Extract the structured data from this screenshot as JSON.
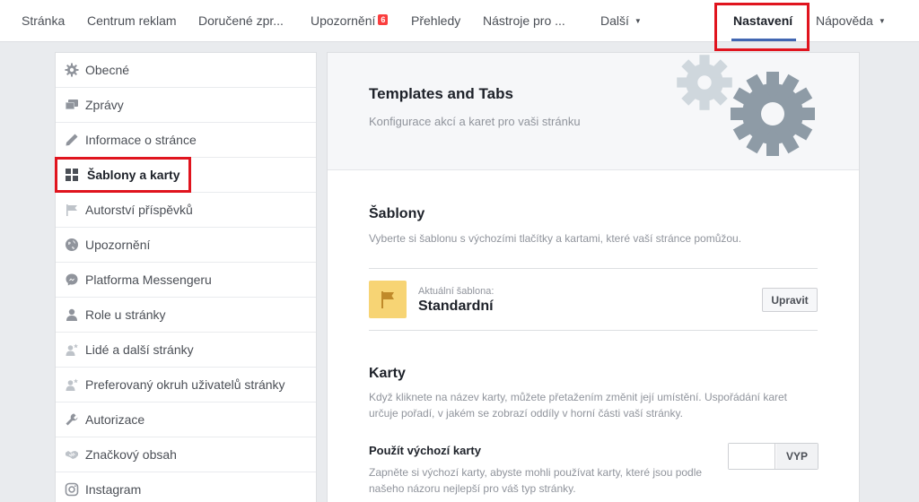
{
  "topnav": {
    "items": [
      {
        "label": "Stránka"
      },
      {
        "label": "Centrum reklam"
      },
      {
        "label": "Doručené zpr..."
      },
      {
        "label": "Upozornění",
        "badge": "6"
      },
      {
        "label": "Přehledy"
      },
      {
        "label": "Nástroje pro ..."
      },
      {
        "label": "Další"
      },
      {
        "label": "Nastavení",
        "active": true
      },
      {
        "label": "Nápověda"
      }
    ]
  },
  "sidebar": {
    "items": [
      {
        "label": "Obecné",
        "icon": "gear-icon"
      },
      {
        "label": "Zprávy",
        "icon": "messages-icon"
      },
      {
        "label": "Informace o stránce",
        "icon": "pencil-icon"
      },
      {
        "label": "Šablony a karty",
        "icon": "grid-icon",
        "active": true
      },
      {
        "label": "Autorství příspěvků",
        "icon": "flag-icon"
      },
      {
        "label": "Upozornění",
        "icon": "globe-icon"
      },
      {
        "label": "Platforma Messengeru",
        "icon": "messenger-icon"
      },
      {
        "label": "Role u stránky",
        "icon": "person-icon"
      },
      {
        "label": "Lidé a další stránky",
        "icon": "person-star-icon"
      },
      {
        "label": "Preferovaný okruh uživatelů stránky",
        "icon": "person-star-icon"
      },
      {
        "label": "Autorizace",
        "icon": "wrench-icon"
      },
      {
        "label": "Značkový obsah",
        "icon": "handshake-icon"
      },
      {
        "label": "Instagram",
        "icon": "instagram-icon"
      }
    ]
  },
  "main": {
    "header": {
      "title": "Templates and Tabs",
      "subtitle": "Konfigurace akcí a karet pro vaši stránku"
    },
    "templates": {
      "title": "Šablony",
      "description": "Vyberte si šablonu s výchozími tlačítky a kartami, které vaší stránce pomůžou.",
      "current_caption": "Aktuální šablona:",
      "current_name": "Standardní",
      "edit_label": "Upravit"
    },
    "tabs": {
      "title": "Karty",
      "description": "Když kliknete na název karty, můžete přetažením změnit její umístění. Uspořádání karet určuje pořadí, v jakém se zobrazí oddíly v horní části vaší stránky.",
      "default_title": "Použít výchozí karty",
      "default_description": "Zapněte si výchozí karty, abyste mohli používat karty, které jsou podle našeho názoru nejlepší pro váš typ stránky.",
      "toggle_state": "VYP"
    }
  },
  "colors": {
    "accent": "#4267b2",
    "highlight": "#e0141e",
    "badge": "#fa3e3e",
    "template_icon_bg": "#f7d474",
    "gear_light": "#cfd7dd",
    "gear_dark": "#8e9ba6"
  }
}
